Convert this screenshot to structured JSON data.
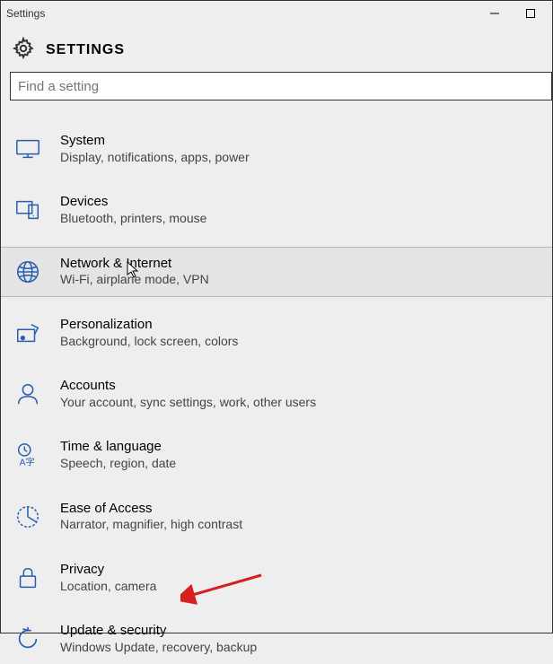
{
  "window": {
    "title": "Settings"
  },
  "header": {
    "label": "SETTINGS"
  },
  "search": {
    "placeholder": "Find a setting"
  },
  "items": [
    {
      "id": "system",
      "title": "System",
      "desc": "Display, notifications, apps, power",
      "hovered": false
    },
    {
      "id": "devices",
      "title": "Devices",
      "desc": "Bluetooth, printers, mouse",
      "hovered": false
    },
    {
      "id": "network",
      "title": "Network & Internet",
      "desc": "Wi-Fi, airplane mode, VPN",
      "hovered": true
    },
    {
      "id": "personalization",
      "title": "Personalization",
      "desc": "Background, lock screen, colors",
      "hovered": false
    },
    {
      "id": "accounts",
      "title": "Accounts",
      "desc": "Your account, sync settings, work, other users",
      "hovered": false
    },
    {
      "id": "time",
      "title": "Time & language",
      "desc": "Speech, region, date",
      "hovered": false
    },
    {
      "id": "ease",
      "title": "Ease of Access",
      "desc": "Narrator, magnifier, high contrast",
      "hovered": false
    },
    {
      "id": "privacy",
      "title": "Privacy",
      "desc": "Location, camera",
      "hovered": false
    },
    {
      "id": "update",
      "title": "Update & security",
      "desc": "Windows Update, recovery, backup",
      "hovered": false
    }
  ],
  "annotation": {
    "arrow_color": "#d62020"
  }
}
